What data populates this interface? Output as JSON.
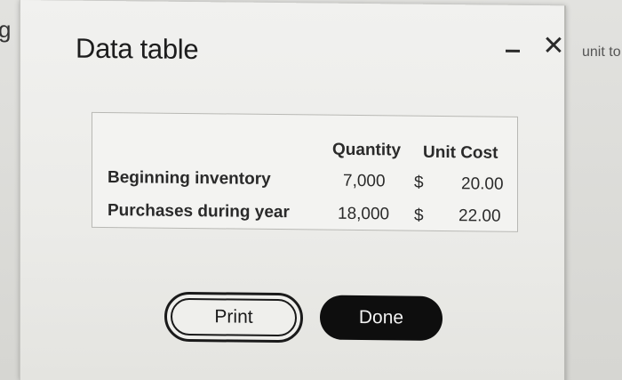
{
  "background": {
    "left_fragment": "g",
    "right_fragment": "unit to"
  },
  "dialog": {
    "title": "Data table",
    "minimize_icon": "minimize-icon",
    "close_icon": "close-icon",
    "close_glyph": "✕"
  },
  "table": {
    "headers": {
      "quantity": "Quantity",
      "unit_cost": "Unit Cost"
    },
    "rows": [
      {
        "label": "Beginning inventory",
        "quantity": "7,000",
        "currency": "$",
        "unit_cost": "20.00"
      },
      {
        "label": "Purchases during year",
        "quantity": "18,000",
        "currency": "$",
        "unit_cost": "22.00"
      }
    ]
  },
  "buttons": {
    "print_label": "Print",
    "done_label": "Done"
  }
}
